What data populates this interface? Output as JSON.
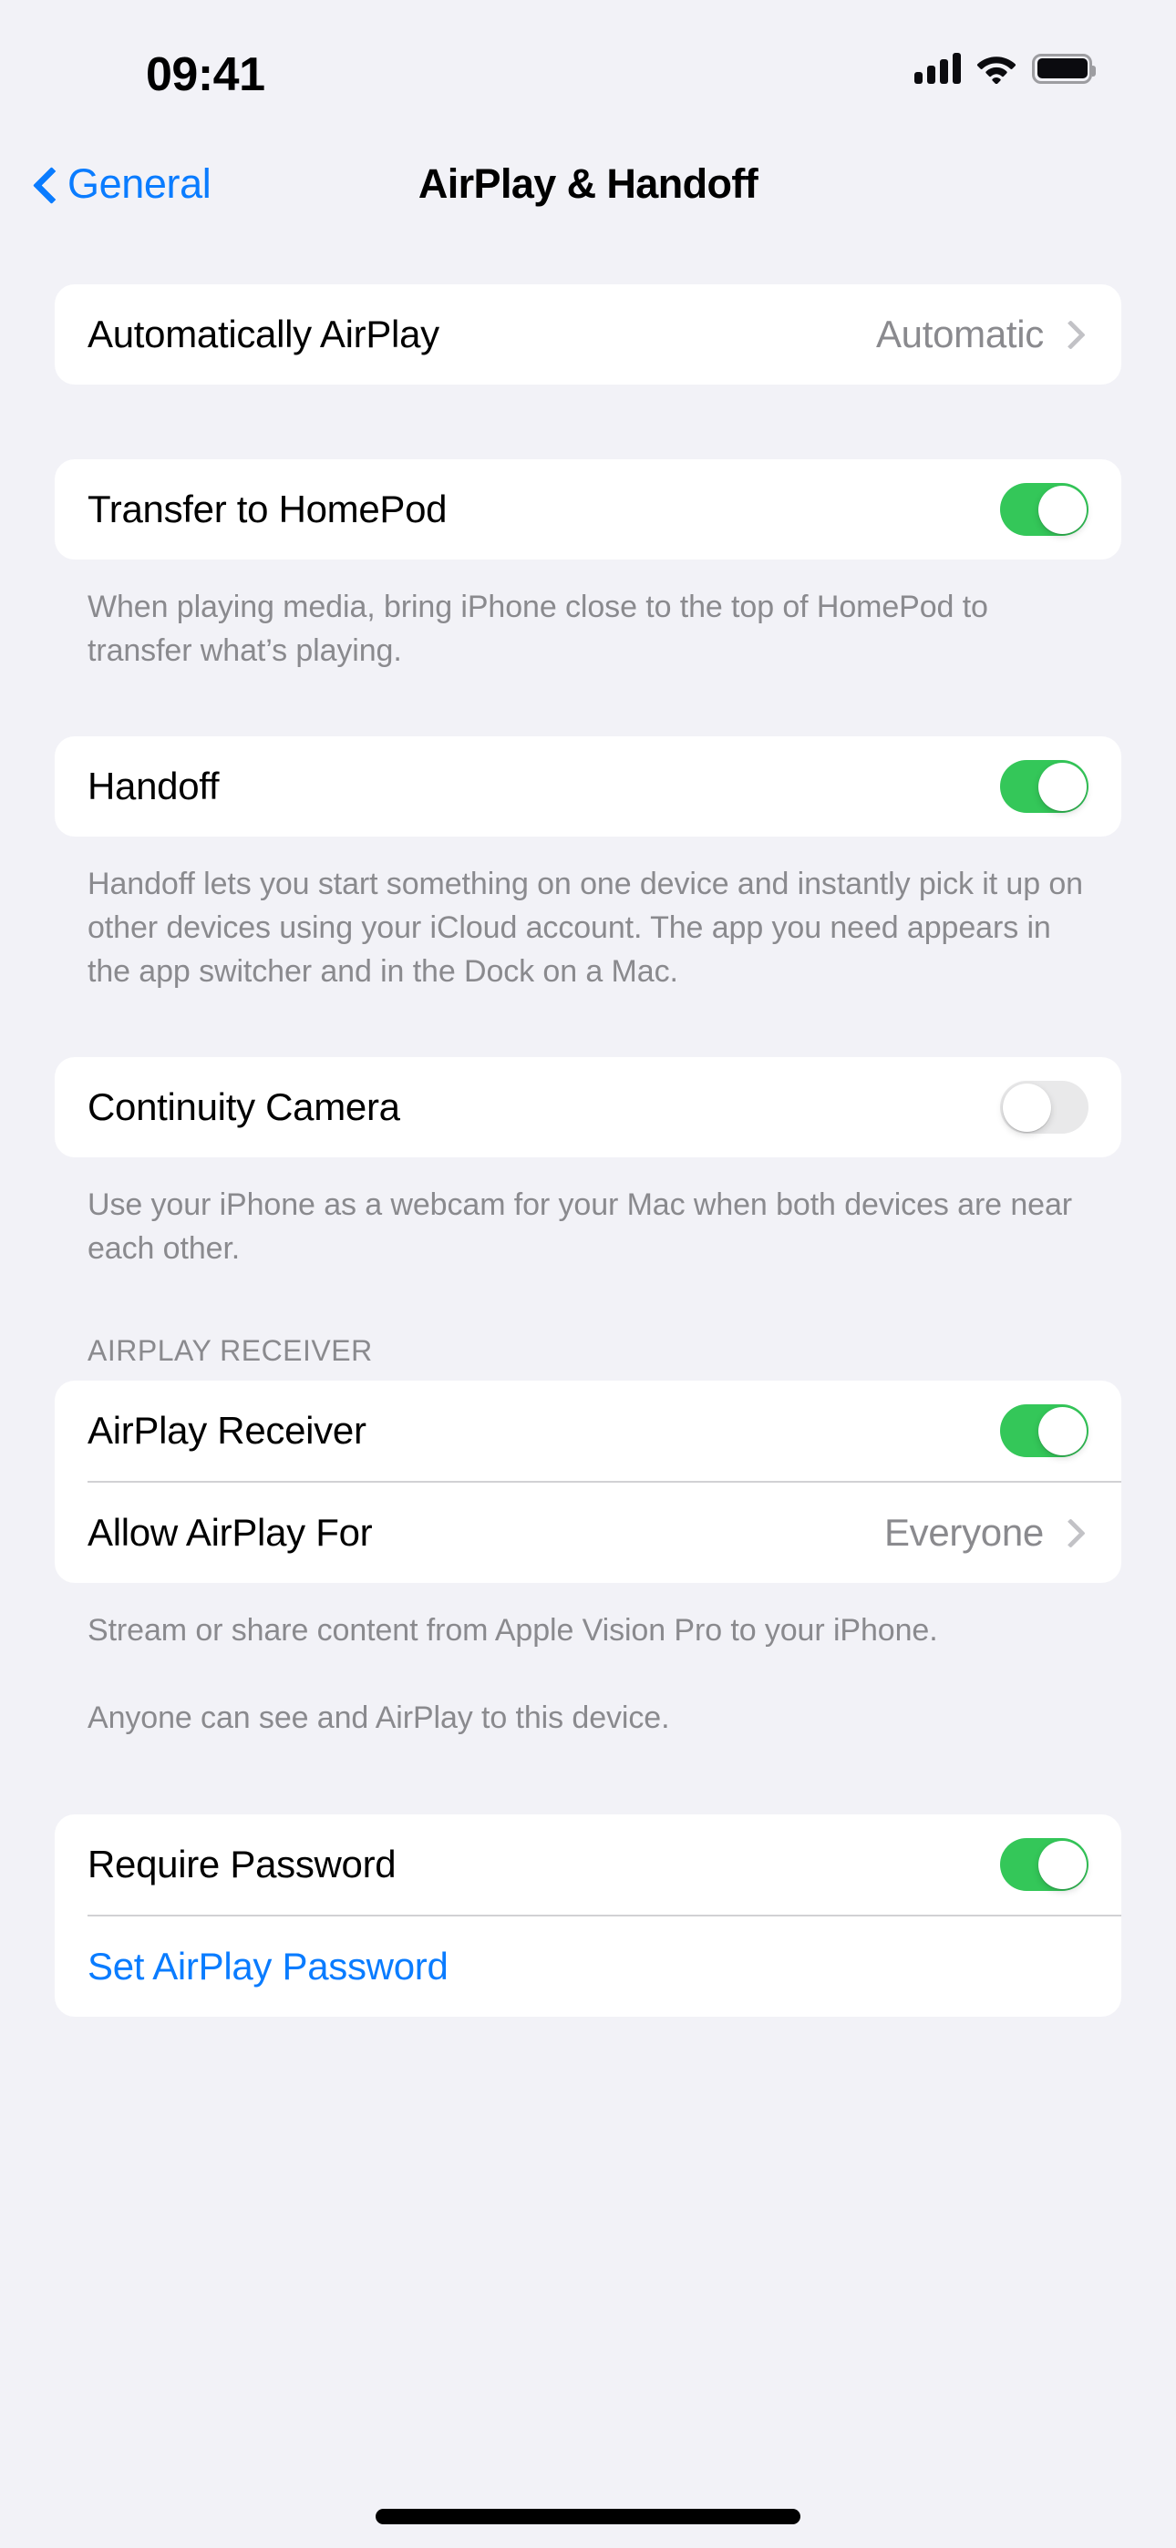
{
  "status_bar": {
    "time": "09:41",
    "cellular_icon": "cellular-bars-icon",
    "wifi_icon": "wifi-icon",
    "battery_icon": "battery-full-icon"
  },
  "nav": {
    "back_label": "General",
    "back_icon": "chevron-left-icon",
    "title": "AirPlay & Handoff"
  },
  "colors": {
    "accent_blue": "#0A7CFF",
    "toggle_on_green": "#34C759",
    "toggle_off_gray": "#E9E9EA",
    "background": "#F2F2F7",
    "card": "#FFFFFF",
    "secondary_text": "#8A8A8E"
  },
  "groups": [
    {
      "id": "automatically-airplay",
      "rows": [
        {
          "label": "Automatically AirPlay",
          "value": "Automatic",
          "accessory": "chevron"
        }
      ]
    },
    {
      "id": "transfer-to-homepod",
      "rows": [
        {
          "label": "Transfer to HomePod",
          "accessory": "toggle",
          "toggle_state": "on"
        }
      ],
      "footer": [
        "When playing media, bring iPhone close to the top of HomePod to transfer what’s playing."
      ]
    },
    {
      "id": "handoff",
      "rows": [
        {
          "label": "Handoff",
          "accessory": "toggle",
          "toggle_state": "on"
        }
      ],
      "footer": [
        "Handoff lets you start something on one device and instantly pick it up on other devices using your iCloud account. The app you need appears in the app switcher and in the Dock on a Mac."
      ]
    },
    {
      "id": "continuity-camera",
      "rows": [
        {
          "label": "Continuity Camera",
          "accessory": "toggle",
          "toggle_state": "off"
        }
      ],
      "footer": [
        "Use your iPhone as a webcam for your Mac when both devices are near each other."
      ]
    },
    {
      "id": "airplay-receiver",
      "header": "AIRPLAY RECEIVER",
      "rows": [
        {
          "label": "AirPlay Receiver",
          "accessory": "toggle",
          "toggle_state": "on"
        },
        {
          "label": "Allow AirPlay For",
          "value": "Everyone",
          "accessory": "chevron"
        }
      ],
      "footer": [
        "Stream or share content from Apple Vision Pro to your iPhone.",
        "Anyone can see and AirPlay to this device."
      ]
    },
    {
      "id": "require-password",
      "rows": [
        {
          "label": "Require Password",
          "accessory": "toggle",
          "toggle_state": "on"
        },
        {
          "label": "Set AirPlay Password",
          "accessory": "none",
          "style": "link"
        }
      ]
    }
  ]
}
